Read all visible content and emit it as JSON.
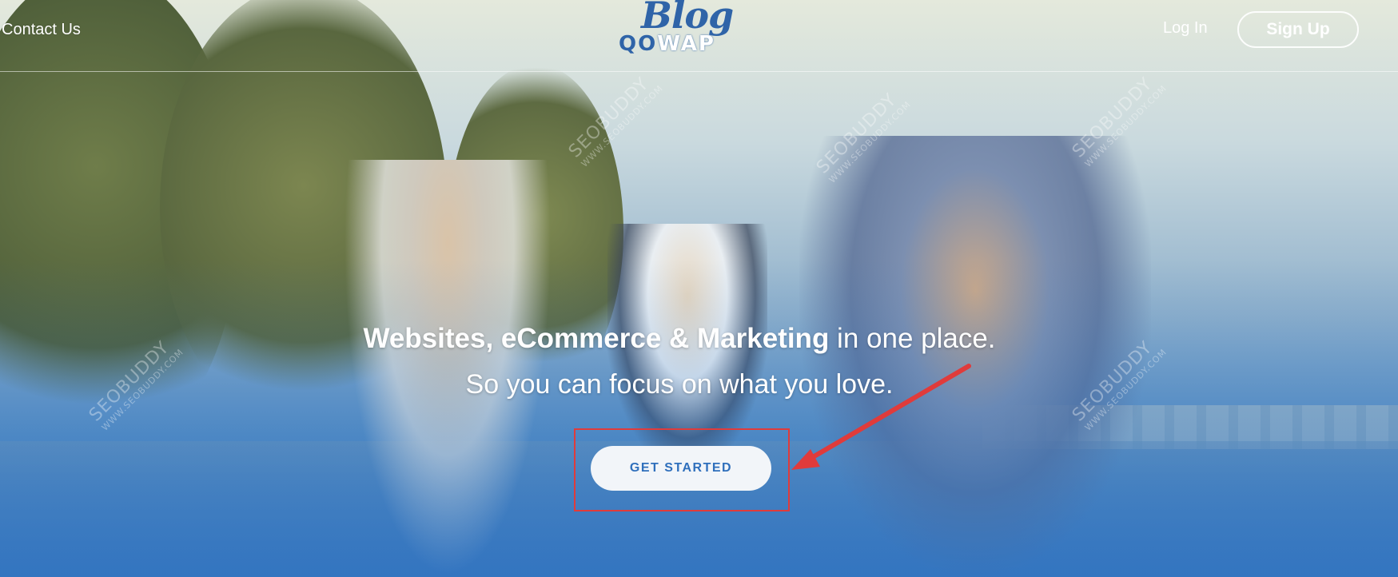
{
  "header": {
    "contact_label": "Contact Us",
    "login_label": "Log In",
    "signup_label": "Sign Up",
    "logo": {
      "script": "Blog",
      "word_part1": "QO",
      "word_part2": "WAP"
    }
  },
  "hero": {
    "headline_bold": "Websites, eCommerce & Marketing",
    "headline_rest": " in one place.",
    "subline": "So you can focus on what you love.",
    "cta_label": "GET STARTED"
  },
  "annotation": {
    "color": "#e03b3b"
  },
  "watermark": {
    "text": "SEOBUDDY",
    "url": "WWW.SEOBUDDY.COM"
  },
  "colors": {
    "brand_blue": "#2f64a8",
    "cta_text": "#2f6fbc",
    "cta_bg": "#f2f5f9"
  }
}
